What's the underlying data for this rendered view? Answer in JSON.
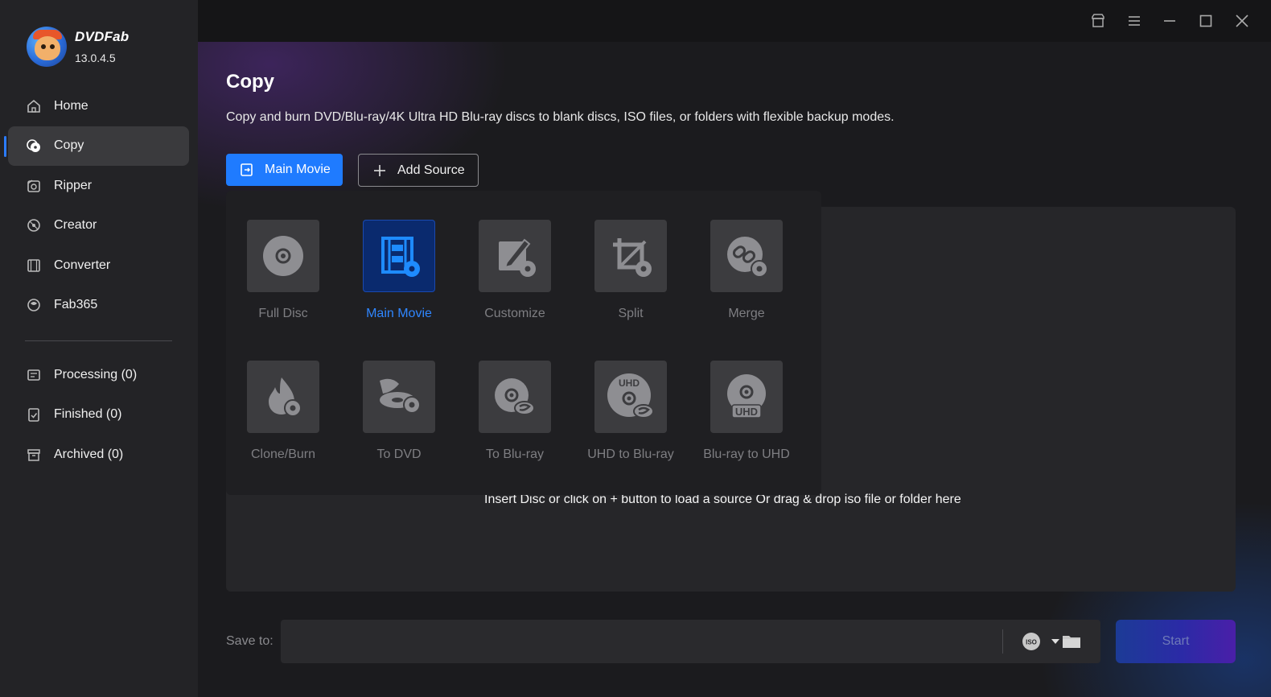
{
  "app": {
    "name": "DVDFab",
    "version": "13.0.4.5"
  },
  "sidebar": {
    "items": [
      {
        "label": "Home",
        "icon": "home-icon"
      },
      {
        "label": "Copy",
        "icon": "copy-disc-icon",
        "active": true
      },
      {
        "label": "Ripper",
        "icon": "ripper-icon"
      },
      {
        "label": "Creator",
        "icon": "creator-icon"
      },
      {
        "label": "Converter",
        "icon": "converter-film-icon"
      },
      {
        "label": "Fab365",
        "icon": "fab365-icon"
      }
    ],
    "queue": [
      {
        "label": "Processing (0)",
        "icon": "processing-icon"
      },
      {
        "label": "Finished (0)",
        "icon": "finished-icon"
      },
      {
        "label": "Archived (0)",
        "icon": "archived-icon"
      }
    ]
  },
  "titlebar": {
    "icons": [
      "shop-icon",
      "menu-icon",
      "minimize-icon",
      "maximize-icon",
      "close-icon"
    ]
  },
  "page": {
    "title": "Copy",
    "description": "Copy and burn DVD/Blu-ray/4K Ultra HD Blu-ray discs to blank discs, ISO files, or folders with flexible backup modes."
  },
  "toolbar": {
    "mode_button_label": "Main Movie",
    "add_source_label": "Add Source"
  },
  "modes": [
    {
      "label": "Full Disc",
      "icon": "full-disc-icon"
    },
    {
      "label": "Main Movie",
      "icon": "main-movie-icon",
      "active": true
    },
    {
      "label": "Customize",
      "icon": "customize-icon"
    },
    {
      "label": "Split",
      "icon": "split-icon"
    },
    {
      "label": "Merge",
      "icon": "merge-icon"
    },
    {
      "label": "Clone/Burn",
      "icon": "clone-burn-icon"
    },
    {
      "label": "To DVD",
      "icon": "to-dvd-icon"
    },
    {
      "label": "To Blu-ray",
      "icon": "to-bluray-icon"
    },
    {
      "label": "UHD to Blu-ray",
      "icon": "uhd-to-bluray-icon"
    },
    {
      "label": "Blu-ray to UHD",
      "icon": "bluray-to-uhd-icon"
    }
  ],
  "drop_area": {
    "hint": "Insert Disc or click on + button to load a source Or drag & drop iso file or folder here"
  },
  "save": {
    "label": "Save to:",
    "value": "",
    "start_label": "Start",
    "iso_text": "ISO"
  },
  "colors": {
    "accent": "#1f7bff",
    "sidebar_bg": "#232326",
    "main_bg": "#1b1b1e",
    "active_mode_label": "#2f86ff"
  }
}
